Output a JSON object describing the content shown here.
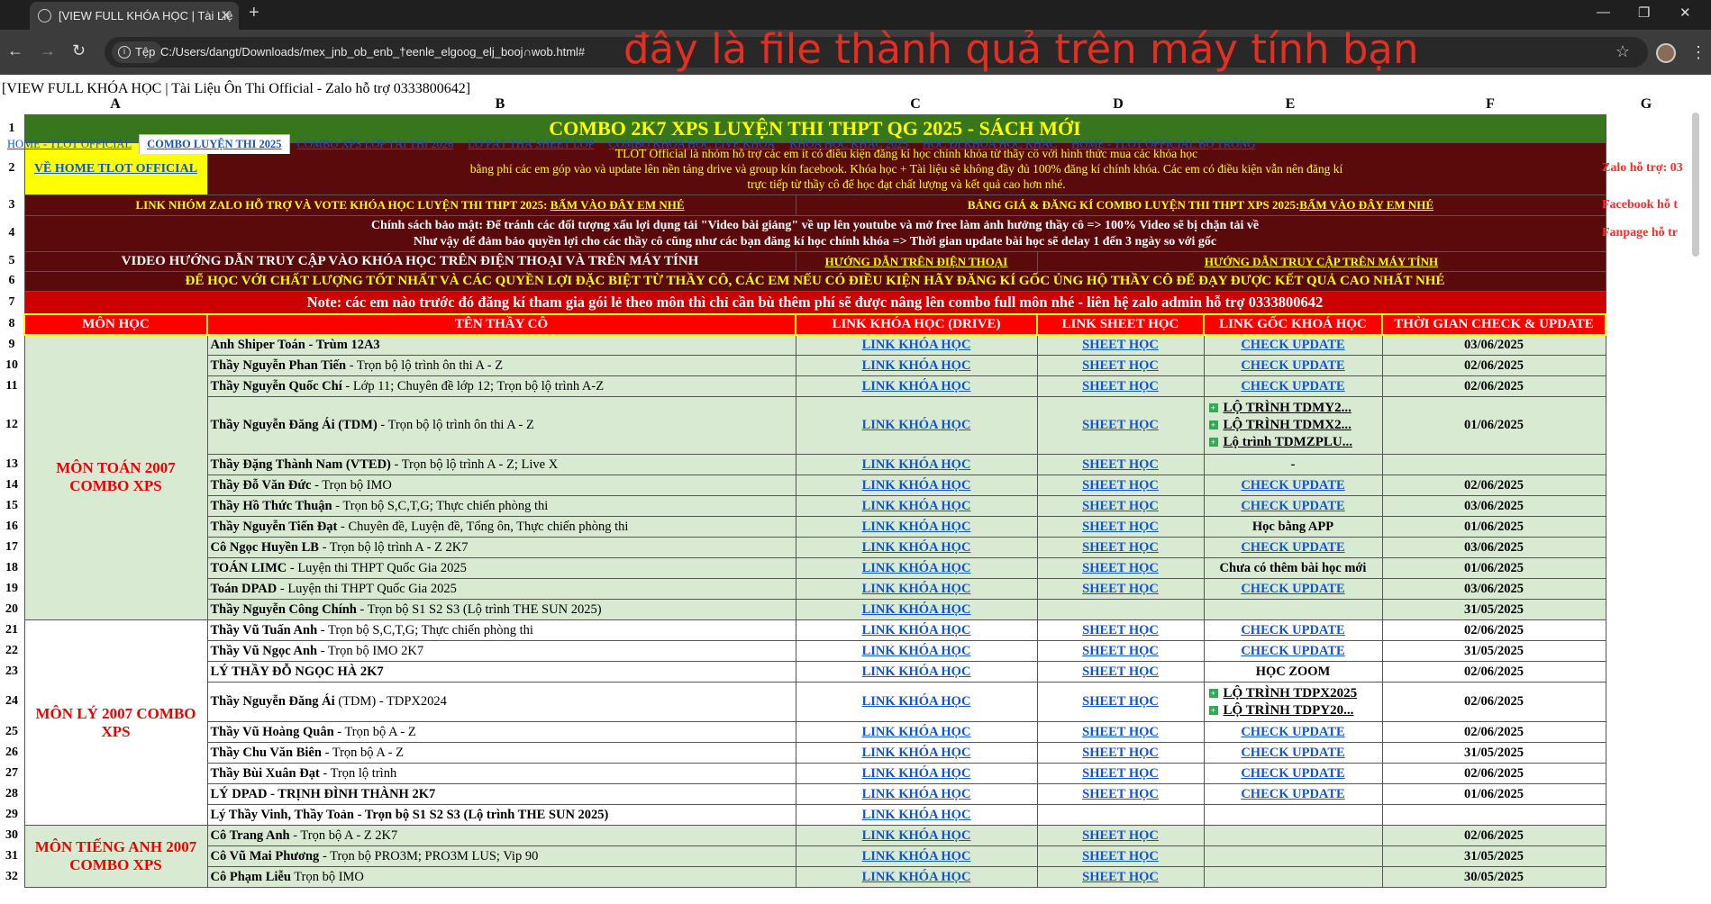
{
  "browser": {
    "tab_title": "[VIEW FULL KHÓA HỌC | Tài Liệ",
    "tab_close": "✕",
    "new_tab": "+",
    "site_info": "Tệp",
    "url": "C:/Users/dangt/Downloads/mex_jnb_ob_enb_†eenle_elgoog_elj_booj∩wob.html#",
    "overlay_note": "đây là file thành quả trên máy tính bạn"
  },
  "doc_title": "[VIEW FULL KHÓA HỌC | Tài Liệu Ôn Thi Official - Zalo hỗ trợ 0333800642]",
  "columns": [
    "A",
    "B",
    "C",
    "D",
    "E",
    "F",
    "G"
  ],
  "sheet_tabs": [
    "HOME - TLOT OFFICIAL",
    "COMBO LUYỆN THI 2025",
    "COMBO XPS LỚP TÀI THI 2026",
    "LỚ PẢT THẢ SHEET LỚP",
    "COMBO KHÓA HỌC LIVE KHÓA",
    "KHÓA HỌC KHÁC 2025",
    "HỌC ĐI KHÓA HỌC KHÁC",
    "HOME - TLOT OFFICIAL BỘ TRỐNG"
  ],
  "header": {
    "title": "COMBO 2K7 XPS LUYỆN THI THPT QG 2025 - SÁCH MỚI",
    "home_link": "VỀ HOME TLOT OFFICIAL",
    "intro_line1": "TLOT Official là nhóm hỗ trợ các em ít có điều kiện đăng kí học chính khóa từ thầy cô với hình thức mua các khóa học",
    "intro_line2": "bằng phí các em góp vào và update lên nền tảng drive và group kín facebook. Khóa học + Tài liệu sẽ không đầy đủ 100% đăng kí chính khóa. Các em có điều kiện vẫn nên đăng kí",
    "intro_line3": "trực tiếp từ thầy cô để học đạt chất lượng và kết quả cao hơn nhé.",
    "zalo_group_label": "LINK NHÓM ZALO HỖ TRỢ VÀ VOTE KHÓA HỌC LUYỆN THI THPT 2025: ",
    "zalo_group_link": "BẤM VÀO ĐÂY EM NHÉ",
    "price_label": "BẢNG GIÁ & ĐĂNG KÍ COMBO LUYỆN THI THPT XPS 2025:",
    "price_link": "BẤM VÀO ĐÂY EM NHÉ",
    "policy_line1": "Chính sách bảo mật: Để tránh các đối tượng xấu lợi dụng tải \"Video bài giảng\" về up lên youtube và mở free làm ảnh hưởng thầy cô => 100% Video sẽ bị chặn tải về",
    "policy_line2": "Như vậy để đảm bảo quyền lợi cho các thầy cô cũng như các bạn đăng kí học chính khóa => Thời gian update bài học sẽ delay 1 đến 3 ngày so với gốc",
    "video_guide": "VIDEO HƯỚNG DẪN TRUY CẬP VÀO KHÓA HỌC TRÊN ĐIỆN THOẠI VÀ TRÊN MÁY TÍNH",
    "guide_phone": "HƯỚNG DẪN TRÊN ĐIỆN THOẠI",
    "guide_pc": "HƯỚNG DẪN TRUY CẬP TRÊN MÁY TÍNH",
    "quality_note": "ĐỂ HỌC VỚI CHẤT LƯỢNG TỐT NHẤT VÀ CÁC QUYỀN LỢI ĐẶC BIỆT TỪ THẦY CÔ, CÁC EM NẾU CÓ ĐIỀU KIỆN HÃY ĐĂNG KÍ GỐC ỦNG HỘ THẦY CÔ ĐỂ ĐẠY ĐƯỢC KẾT QUẢ CAO NHẤT NHÉ",
    "combo_note": "Note: các em nào trước đó đăng kí tham gia gói lẻ theo môn thì chỉ cần bù thêm phí sẽ được nâng lên combo full môn nhé - liên hệ zalo admin hỗ trợ 0333800642",
    "side_zalo": "Zalo hỗ trợ: 03",
    "side_facebook": "Facebook hỗ t",
    "side_fanpage": "Fanpage hỗ tr"
  },
  "table_headers": [
    "MÔN HỌC",
    "TÊN THẦY CÔ",
    "LINK KHÓA HỌC (DRIVE)",
    "LINK SHEET HỌC",
    "LINK GỐC KHOÁ HỌC",
    "THỜI GIAN CHECK & UPDATE"
  ],
  "link_course": "LINK KHÓA HỌC",
  "link_sheet": "SHEET HỌC",
  "subjects": {
    "math": "MÔN TOÁN 2007 COMBO XPS",
    "physics": "MÔN LÝ 2007 COMBO XPS",
    "english": "MÔN TIẾNG ANH 2007 COMBO XPS"
  },
  "rows": [
    {
      "n": "9",
      "bold": "Anh Shiper Toán - Trùm 12A3",
      "rest": "",
      "sheet": true,
      "orig": "CHECK UPDATE",
      "date": "03/06/2025"
    },
    {
      "n": "10",
      "bold": "Thầy Nguyễn Phan Tiến",
      "rest": " - Trọn bộ lộ trình ôn thi A - Z",
      "sheet": true,
      "orig": "CHECK UPDATE",
      "date": "02/06/2025"
    },
    {
      "n": "11",
      "bold": "Thầy Nguyễn Quốc Chí",
      "rest": " - Lớp 11; Chuyên đề lớp 12; Trọn bộ lộ trình A-Z",
      "sheet": true,
      "orig": "CHECK UPDATE",
      "date": "02/06/2025"
    },
    {
      "n": "12",
      "bold": "Thầy Nguyễn Đăng Ái (TDM)",
      "rest": " - Trọn bộ lộ trình ôn thi A - Z",
      "sheet": true,
      "progs": [
        "LỘ TRÌNH TDMY2...",
        "LỘ TRÌNH TDMX2...",
        "Lộ trình TDMZPLU..."
      ],
      "date": "01/06/2025"
    },
    {
      "n": "13",
      "bold": "Thầy Đặng Thành Nam (VTED)",
      "rest": " - Trọn bộ lộ trình A - Z; Live X",
      "sheet": true,
      "orig": "-",
      "date": ""
    },
    {
      "n": "14",
      "bold": "Thầy Đỗ Văn Đức",
      "rest": " - Trọn bộ IMO",
      "sheet": true,
      "orig": "CHECK UPDATE",
      "date": "02/06/2025"
    },
    {
      "n": "15",
      "bold": "Thầy Hồ Thức Thuận",
      "rest": " - Trọn bộ S,C,T,G; Thực chiến phòng thi",
      "sheet": true,
      "orig": "CHECK UPDATE",
      "date": "03/06/2025"
    },
    {
      "n": "16",
      "bold": "Thầy Nguyễn Tiến Đạt",
      "rest": " - Chuyên đề, Luyện đề, Tổng ôn, Thực chiến phòng thi",
      "sheet": true,
      "orig_text": "Học bằng APP",
      "date": "01/06/2025"
    },
    {
      "n": "17",
      "bold": "Cô Ngọc Huyền LB",
      "rest": " - Trọn bộ lộ trình A - Z 2K7",
      "sheet": true,
      "orig": "CHECK UPDATE",
      "date": "03/06/2025"
    },
    {
      "n": "18",
      "bold": "TOÁN LIMC",
      "rest": " - Luyện thi THPT Quốc Gia 2025",
      "sheet": true,
      "orig_text": "Chưa có thêm bài học mới",
      "date": "01/06/2025"
    },
    {
      "n": "19",
      "bold": "Toán DPAD",
      "rest": " - Luyện thi THPT Quốc Gia 2025",
      "sheet": true,
      "orig": "CHECK UPDATE",
      "date": "03/06/2025"
    },
    {
      "n": "20",
      "bold": "Thầy Nguyễn Công Chính",
      "rest": " - Trọn bộ S1 S2 S3 (Lộ trình THE SUN 2025)",
      "sheet": false,
      "orig": "",
      "date": "31/05/2025"
    },
    {
      "n": "21",
      "bold": "Thầy Vũ Tuấn Anh",
      "rest": " - Trọn bộ S,C,T,G; Thực chiến phòng thi",
      "sheet": true,
      "orig": "CHECK UPDATE",
      "date": "02/06/2025"
    },
    {
      "n": "22",
      "bold": "Thầy Vũ Ngọc Anh",
      "rest": " - Trọn bộ IMO 2K7",
      "sheet": true,
      "orig": "CHECK UPDATE",
      "date": "31/05/2025"
    },
    {
      "n": "23",
      "bold": "LÝ THẦY ĐỖ NGỌC HÀ 2K7",
      "rest": "",
      "sheet": true,
      "orig_text": "HỌC ZOOM",
      "date": "02/06/2025"
    },
    {
      "n": "24",
      "bold": "Thầy Nguyễn Đăng Ái",
      "rest": " (TDM) - TDPX2024",
      "sheet": true,
      "progs": [
        "LỘ TRÌNH TDPX2025",
        "LỘ TRÌNH TDPY20..."
      ],
      "date": "02/06/2025"
    },
    {
      "n": "25",
      "bold": "Thầy Vũ Hoàng Quân",
      "rest": " - Trọn bộ A - Z",
      "sheet": true,
      "orig": "CHECK UPDATE",
      "date": "02/06/2025"
    },
    {
      "n": "26",
      "bold": "Thầy Chu Văn Biên",
      "rest": " - Trọn bộ A - Z",
      "sheet": true,
      "orig": "CHECK UPDATE",
      "date": "31/05/2025"
    },
    {
      "n": "27",
      "bold": "Thầy Bùi Xuân Đạt",
      "rest": " - Trọn lộ trình",
      "sheet": true,
      "orig": "CHECK UPDATE",
      "date": "02/06/2025"
    },
    {
      "n": "28",
      "bold": "LÝ DPAD - TRỊNH ĐÌNH THÀNH 2K7",
      "rest": "",
      "sheet": true,
      "orig": "CHECK UPDATE",
      "date": "01/06/2025"
    },
    {
      "n": "29",
      "bold": "Lý Thầy Vinh, Thầy Toản - Trọn bộ S1 S2 S3 (Lộ trình THE SUN 2025)",
      "rest": "",
      "sheet": false,
      "orig": "",
      "date": ""
    },
    {
      "n": "30",
      "bold": "Cô Trang Anh",
      "rest": " - Trọn bộ A - Z 2K7",
      "sheet": true,
      "orig": "",
      "date": "02/06/2025"
    },
    {
      "n": "31",
      "bold": "Cô Vũ Mai Phương",
      "rest": " - Trọn bộ PRO3M; PRO3M LUS; Vip 90",
      "sheet": true,
      "orig": "",
      "date": "31/05/2025"
    },
    {
      "n": "32",
      "bold": "Cô Phạm Liễu",
      "rest": " Trọn bộ IMO",
      "sheet": true,
      "orig": "",
      "date": "30/05/2025"
    }
  ]
}
